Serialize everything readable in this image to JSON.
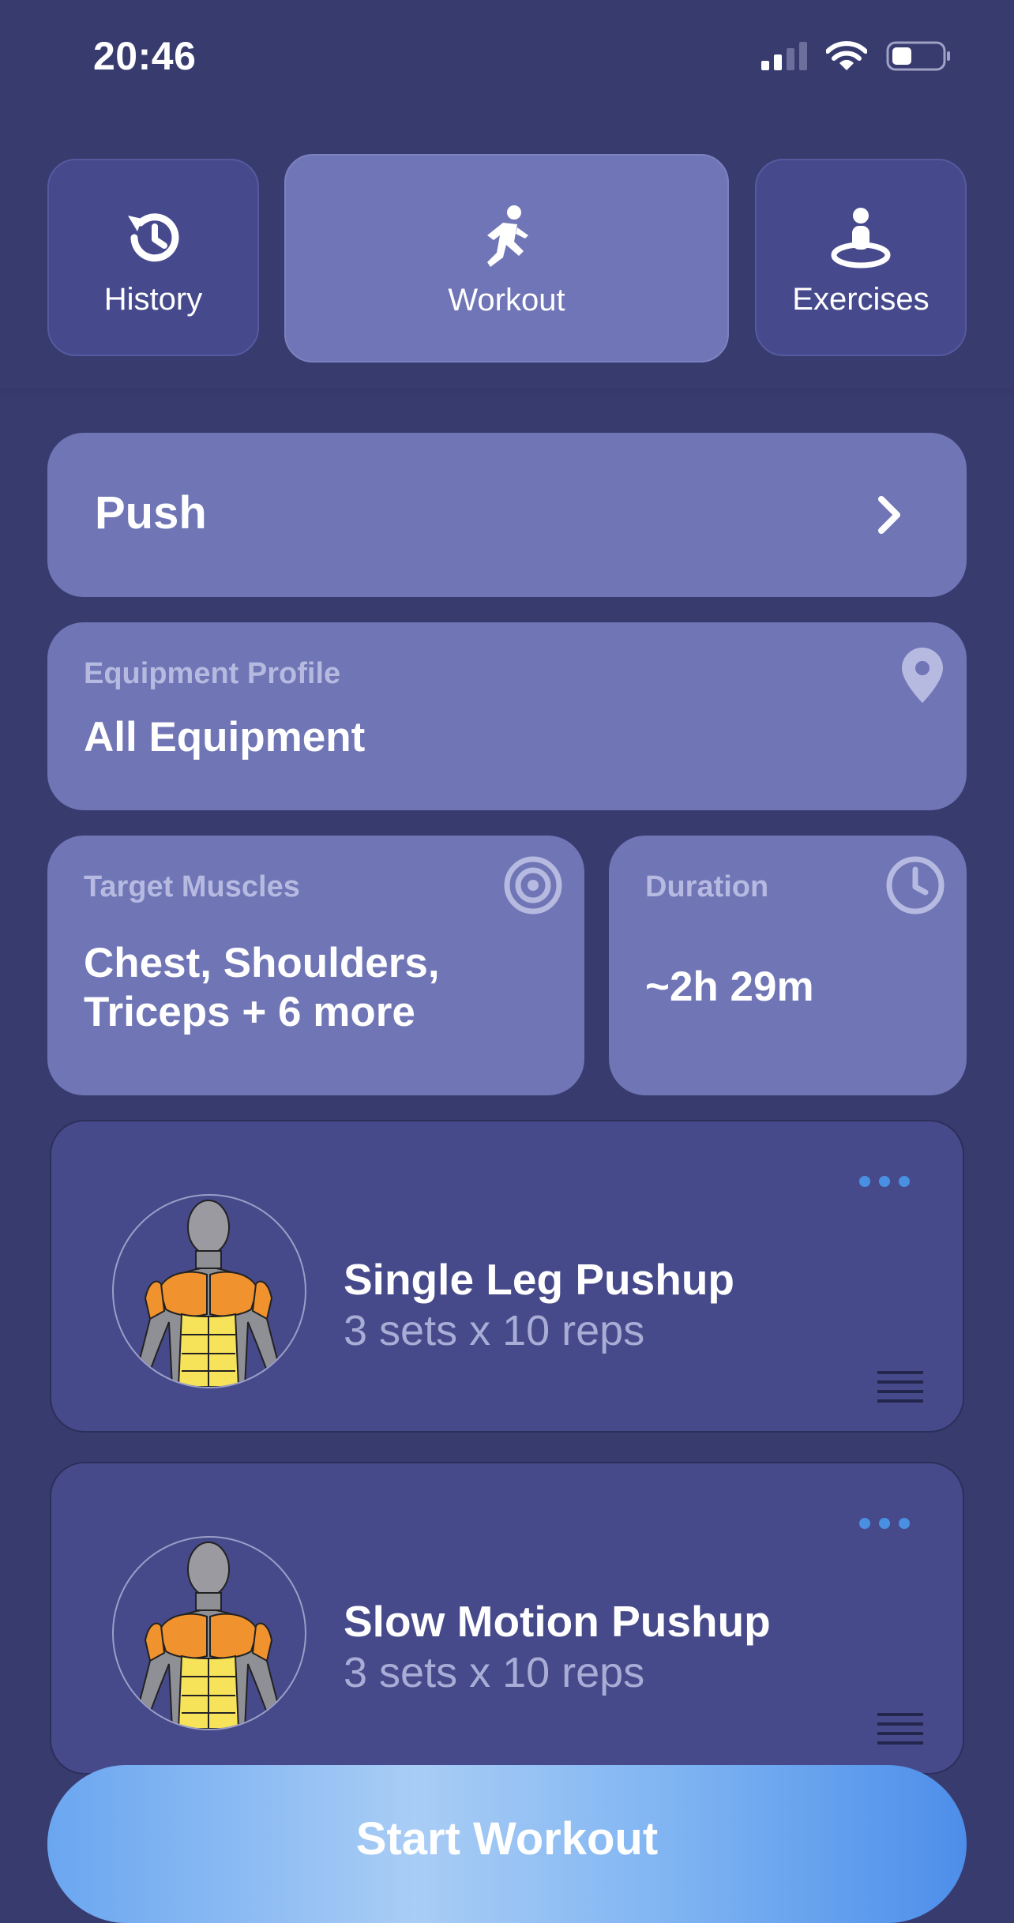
{
  "status_bar": {
    "time": "20:46"
  },
  "nav": {
    "history_label": "History",
    "workout_label": "Workout",
    "exercises_label": "Exercises",
    "active": "Workout"
  },
  "workout": {
    "name": "Push"
  },
  "equipment": {
    "caption": "Equipment Profile",
    "value": "All Equipment",
    "icon": "location-pin-icon"
  },
  "muscles": {
    "caption": "Target Muscles",
    "line1": "Chest, Shoulders,",
    "line2": "Triceps + 6 more",
    "icon": "target-icon"
  },
  "duration": {
    "caption": "Duration",
    "value": "~2h 29m",
    "icon": "clock-icon"
  },
  "exercises": [
    {
      "name": "Single Leg Pushup",
      "sets": "3 sets x 10 reps"
    },
    {
      "name": "Slow Motion Pushup",
      "sets": "3 sets x 10 reps"
    }
  ],
  "start_button": {
    "label": "Start Workout"
  },
  "colors": {
    "background": "#383b6e",
    "card": "#6f75b5",
    "exercise_card": "#464a8a",
    "accent_blue": "#4a90e2",
    "muscle_orange": "#f0922e",
    "muscle_yellow": "#f7e35a"
  }
}
